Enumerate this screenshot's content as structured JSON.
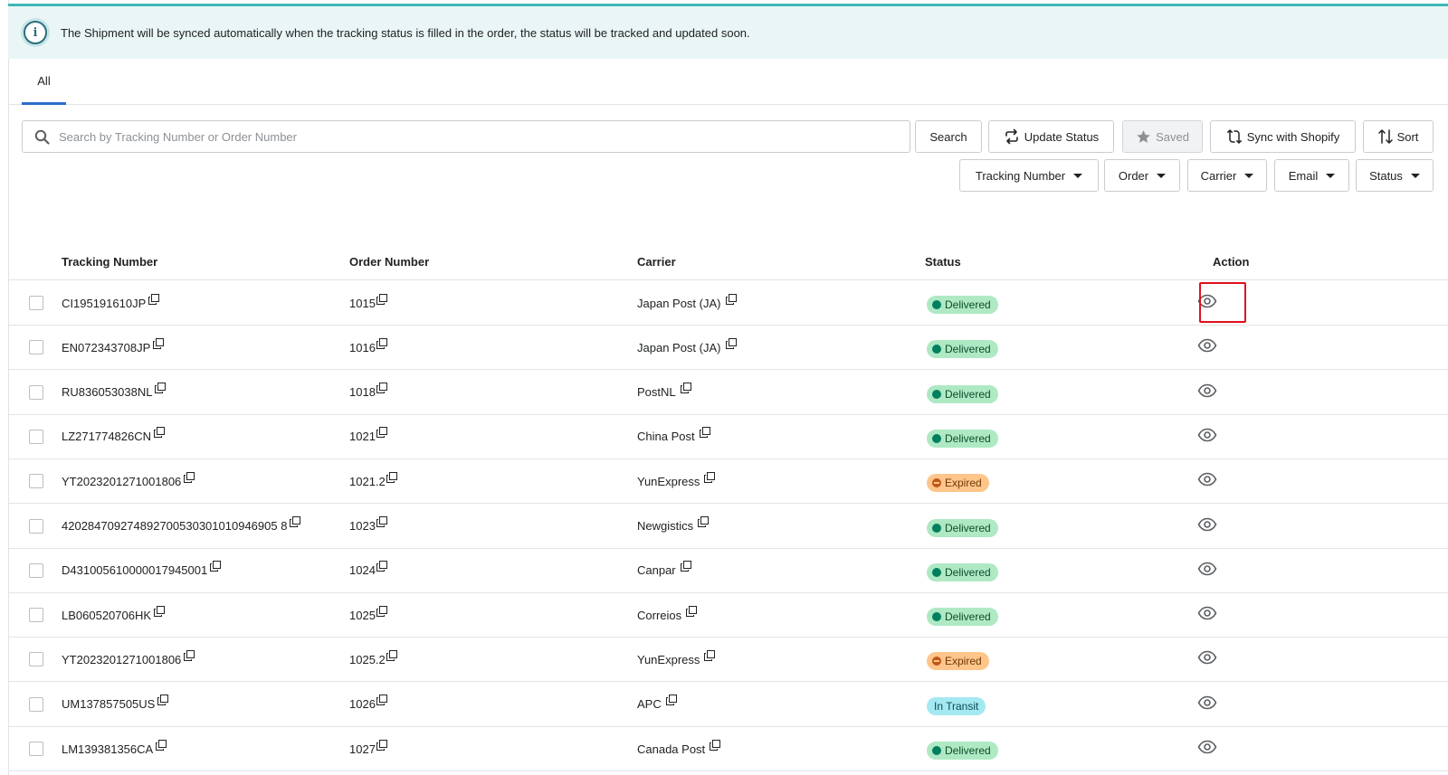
{
  "banner": {
    "icon": "info-icon",
    "text": "The Shipment will be synced automatically when the tracking status is filled in the order, the status will be tracked and updated soon."
  },
  "tabs": [
    {
      "label": "All",
      "selected": true
    }
  ],
  "search": {
    "placeholder": "Search by Tracking Number or Order Number",
    "value": "",
    "button_label": "Search"
  },
  "toolbar": {
    "update_status_label": "Update Status",
    "saved_label": "Saved",
    "sync_label": "Sync with Shopify",
    "sort_label": "Sort"
  },
  "filters": {
    "tracking_number": "Tracking Number",
    "order": "Order",
    "carrier": "Carrier",
    "email": "Email",
    "status": "Status"
  },
  "table": {
    "headers": {
      "tracking_number": "Tracking Number",
      "order_number": "Order Number",
      "carrier": "Carrier",
      "status": "Status",
      "action": "Action"
    },
    "rows": [
      {
        "tracking": "CI195191610JP",
        "order": "1015",
        "carrier": "Japan Post (JA)",
        "status": "Delivered"
      },
      {
        "tracking": "EN072343708JP",
        "order": "1016",
        "carrier": "Japan Post (JA)",
        "status": "Delivered"
      },
      {
        "tracking": "RU836053038NL",
        "order": "1018",
        "carrier": "PostNL",
        "status": "Delivered"
      },
      {
        "tracking": "LZ271774826CN",
        "order": "1021",
        "carrier": "China Post",
        "status": "Delivered"
      },
      {
        "tracking": "YT2023201271001806",
        "order": "1021.2",
        "carrier": "YunExpress",
        "status": "Expired"
      },
      {
        "tracking": "420284709274892700530301010946905 8",
        "order": "1023",
        "carrier": "Newgistics",
        "status": "Delivered"
      },
      {
        "tracking": "D431005610000017945001",
        "order": "1024",
        "carrier": "Canpar",
        "status": "Delivered"
      },
      {
        "tracking": "LB060520706HK",
        "order": "1025",
        "carrier": "Correios",
        "status": "Delivered"
      },
      {
        "tracking": "YT2023201271001806",
        "order": "1025.2",
        "carrier": "YunExpress",
        "status": "Expired"
      },
      {
        "tracking": "UM137857505US",
        "order": "1026",
        "carrier": "APC",
        "status": "In Transit"
      },
      {
        "tracking": "LM139381356CA",
        "order": "1027",
        "carrier": "Canada Post",
        "status": "Delivered"
      }
    ]
  },
  "colors": {
    "accent": "#2c6ecb",
    "banner_bg": "#eaf6f6",
    "delivered_bg": "#aee9c4",
    "expired_bg": "#ffc58b",
    "transit_bg": "#a4e8f2",
    "highlight": "#e0101d"
  }
}
